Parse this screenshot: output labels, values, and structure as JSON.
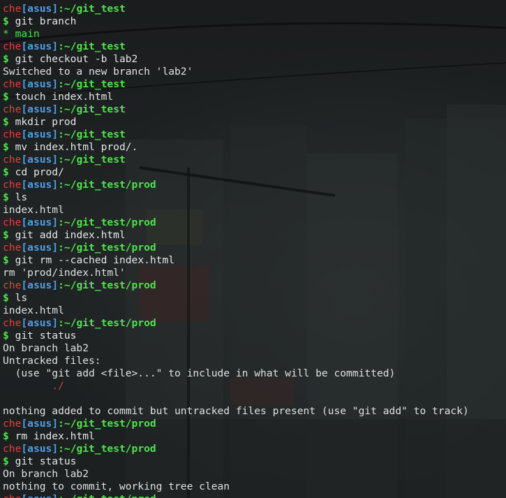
{
  "prompt": {
    "user": "che",
    "open": "[",
    "host": "asus",
    "close": "]",
    "sep": ":",
    "dollar": "$"
  },
  "lines": [
    {
      "kind": "prompt",
      "path": "~/git_test"
    },
    {
      "kind": "cmd",
      "text": "git branch"
    },
    {
      "kind": "out",
      "style": "green",
      "text": "* main"
    },
    {
      "kind": "prompt",
      "path": "~/git_test"
    },
    {
      "kind": "cmd",
      "text": "git checkout -b lab2"
    },
    {
      "kind": "out",
      "text": "Switched to a new branch 'lab2'"
    },
    {
      "kind": "prompt",
      "path": "~/git_test"
    },
    {
      "kind": "cmd",
      "text": "touch index.html"
    },
    {
      "kind": "prompt",
      "path": "~/git_test"
    },
    {
      "kind": "cmd",
      "text": "mkdir prod"
    },
    {
      "kind": "prompt",
      "path": "~/git_test"
    },
    {
      "kind": "cmd",
      "text": "mv index.html prod/."
    },
    {
      "kind": "prompt",
      "path": "~/git_test"
    },
    {
      "kind": "cmd",
      "text": "cd prod/"
    },
    {
      "kind": "prompt",
      "path": "~/git_test/prod"
    },
    {
      "kind": "cmd",
      "text": "ls"
    },
    {
      "kind": "out",
      "text": "index.html"
    },
    {
      "kind": "prompt",
      "path": "~/git_test/prod"
    },
    {
      "kind": "cmd",
      "text": "git add index.html"
    },
    {
      "kind": "prompt",
      "path": "~/git_test/prod"
    },
    {
      "kind": "cmd",
      "text": "git rm --cached index.html"
    },
    {
      "kind": "out",
      "text": "rm 'prod/index.html'"
    },
    {
      "kind": "prompt",
      "path": "~/git_test/prod"
    },
    {
      "kind": "cmd",
      "text": "ls"
    },
    {
      "kind": "out",
      "text": "index.html"
    },
    {
      "kind": "prompt",
      "path": "~/git_test/prod"
    },
    {
      "kind": "cmd",
      "text": "git status"
    },
    {
      "kind": "out",
      "text": "On branch lab2"
    },
    {
      "kind": "out",
      "text": "Untracked files:"
    },
    {
      "kind": "out",
      "text": "  (use \"git add <file>...\" to include in what will be committed)"
    },
    {
      "kind": "out",
      "style": "red",
      "text": "        ./"
    },
    {
      "kind": "out",
      "text": ""
    },
    {
      "kind": "out",
      "text": "nothing added to commit but untracked files present (use \"git add\" to track)"
    },
    {
      "kind": "prompt",
      "path": "~/git_test/prod"
    },
    {
      "kind": "cmd",
      "text": "rm index.html"
    },
    {
      "kind": "prompt",
      "path": "~/git_test/prod"
    },
    {
      "kind": "cmd",
      "text": "git status"
    },
    {
      "kind": "out",
      "text": "On branch lab2"
    },
    {
      "kind": "out",
      "text": "nothing to commit, working tree clean"
    },
    {
      "kind": "prompt",
      "path": "~/git_test/prod"
    }
  ]
}
